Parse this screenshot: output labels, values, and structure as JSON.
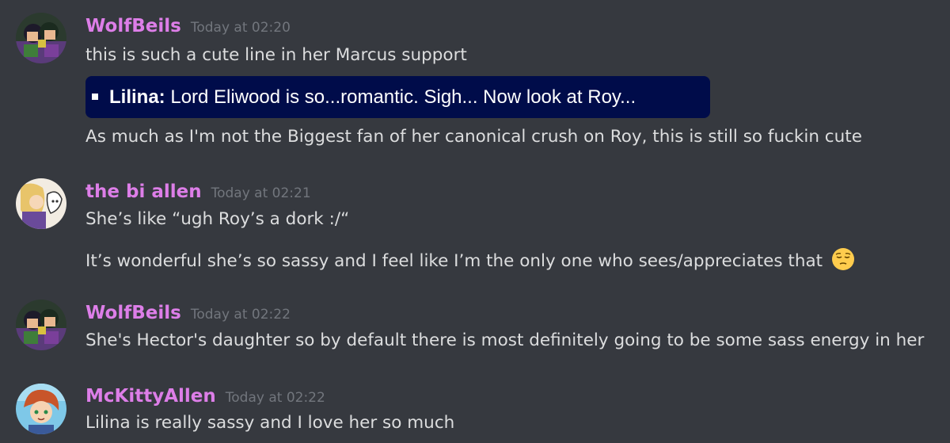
{
  "messages": [
    {
      "username": "WolfBeils",
      "timestamp": "Today at 02:20",
      "lines": [
        "this is such a cute line in her Marcus support"
      ],
      "quote": {
        "speaker": "Lilina:",
        "text": "Lord Eliwood is so...romantic. Sigh... Now look at Roy..."
      },
      "after_lines": [
        "As much as I'm not the Biggest fan of her canonical crush on Roy, this is still so fuckin cute"
      ]
    },
    {
      "username": "the bi allen",
      "timestamp": "Today at 02:21",
      "lines": [
        "She’s like “ugh Roy’s a dork :/“",
        "It’s wonderful she’s so sassy and I feel like I’m the only one who sees/appreciates that"
      ],
      "emoji": "pensive-face"
    },
    {
      "username": "WolfBeils",
      "timestamp": "Today at 02:22",
      "lines": [
        "She's Hector's daughter so by default there is most definitely going to be some sass energy in her"
      ]
    },
    {
      "username": "McKittyAllen",
      "timestamp": "Today at 02:22",
      "lines": [
        "Lilina is really sassy and I love her so much"
      ]
    }
  ],
  "colors": {
    "background": "#36393f",
    "username": "#dd7ee8",
    "timestamp": "#72767d",
    "text": "#dcddde",
    "quote_background": "#000c4a"
  }
}
